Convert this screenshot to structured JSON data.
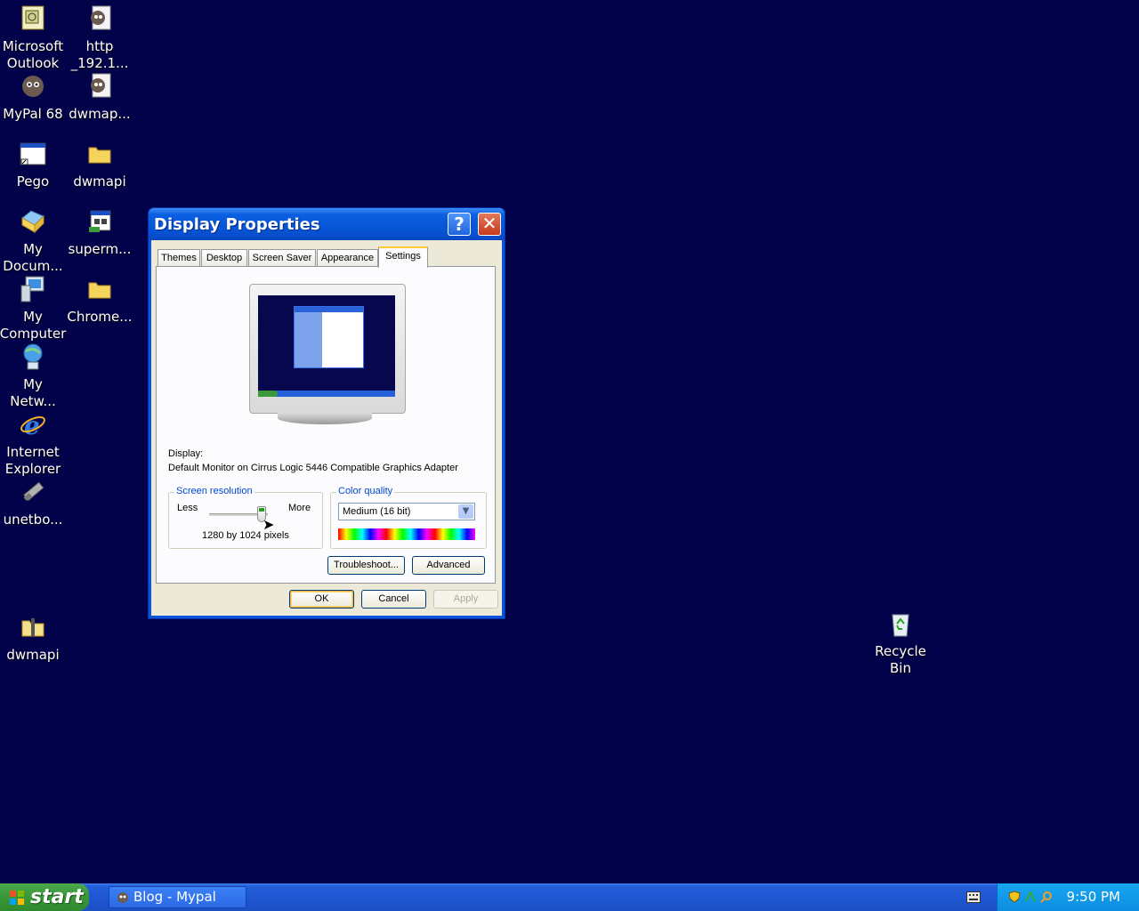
{
  "desktop": {
    "icons": [
      {
        "label": "Microsoft Outlook",
        "icon": "outlook-icon"
      },
      {
        "label": "http _192.1...",
        "icon": "raccoon-doc-icon"
      },
      {
        "label": "MyPal 68",
        "icon": "raccoon-icon"
      },
      {
        "label": "dwmap...",
        "icon": "raccoon-doc-icon"
      },
      {
        "label": "Pego",
        "icon": "app-window-icon"
      },
      {
        "label": "dwmapi",
        "icon": "folder-icon"
      },
      {
        "label": "My Docum...",
        "icon": "my-documents-icon"
      },
      {
        "label": "superm...",
        "icon": "setup-icon"
      },
      {
        "label": "My Computer",
        "icon": "my-computer-icon"
      },
      {
        "label": "Chrome...",
        "icon": "folder-icon"
      },
      {
        "label": "My Netw...",
        "icon": "network-icon"
      },
      {
        "label": "Internet Explorer",
        "icon": "ie-icon"
      },
      {
        "label": "unetbo...",
        "icon": "usb-icon"
      },
      {
        "label": "dwmapi",
        "icon": "zip-folder-icon"
      },
      {
        "label": "Recycle Bin",
        "icon": "recycle-bin-icon"
      }
    ]
  },
  "dialog": {
    "title": "Display Properties",
    "help": "?",
    "close": "✕",
    "tabs": [
      "Themes",
      "Desktop",
      "Screen Saver",
      "Appearance",
      "Settings"
    ],
    "active_tab": "Settings",
    "display_label": "Display:",
    "display_value": "Default Monitor on Cirrus Logic 5446 Compatible Graphics Adapter",
    "resolution": {
      "group_title": "Screen resolution",
      "less": "Less",
      "more": "More",
      "value": "1280 by 1024 pixels",
      "slider_position": 0.9
    },
    "color_quality": {
      "group_title": "Color quality",
      "selected": "Medium (16 bit)"
    },
    "buttons": {
      "troubleshoot": "Troubleshoot...",
      "advanced": "Advanced",
      "ok": "OK",
      "cancel": "Cancel",
      "apply": "Apply"
    }
  },
  "taskbar": {
    "start": "start",
    "task": "Blog - Mypal",
    "clock": "9:50 PM"
  },
  "colors": {
    "desktop": "#02024a",
    "titlebar": "#0654d5",
    "taskbar": "#245edb",
    "start": "#3c9a3c"
  }
}
